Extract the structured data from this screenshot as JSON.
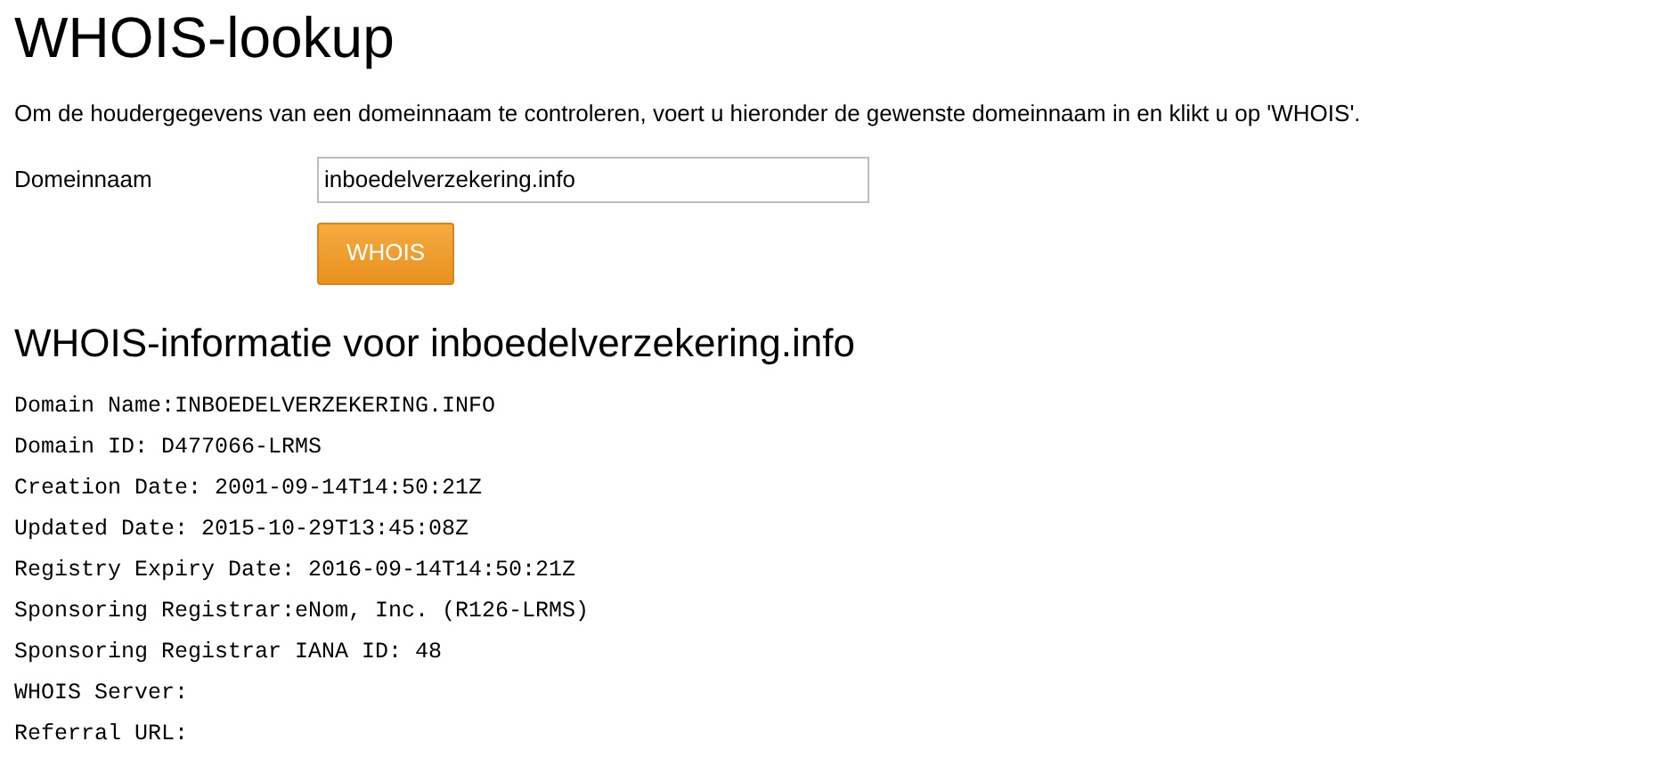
{
  "title": "WHOIS-lookup",
  "intro": "Om de houdergegevens van een domeinnaam te controleren, voert u hieronder de gewenste domeinnaam in en klikt u op 'WHOIS'.",
  "domain_field": {
    "label": "Domeinnaam",
    "value": "inboedelverzekering.info"
  },
  "submit_button": "WHOIS",
  "result_heading": "WHOIS-informatie voor inboedelverzekering.info",
  "result_lines": [
    "Domain Name:INBOEDELVERZEKERING.INFO",
    "Domain ID: D477066-LRMS",
    "Creation Date: 2001-09-14T14:50:21Z",
    "Updated Date: 2015-10-29T13:45:08Z",
    "Registry Expiry Date: 2016-09-14T14:50:21Z",
    "Sponsoring Registrar:eNom, Inc. (R126-LRMS)",
    "Sponsoring Registrar IANA ID: 48",
    "WHOIS Server:",
    "Referral URL:"
  ]
}
